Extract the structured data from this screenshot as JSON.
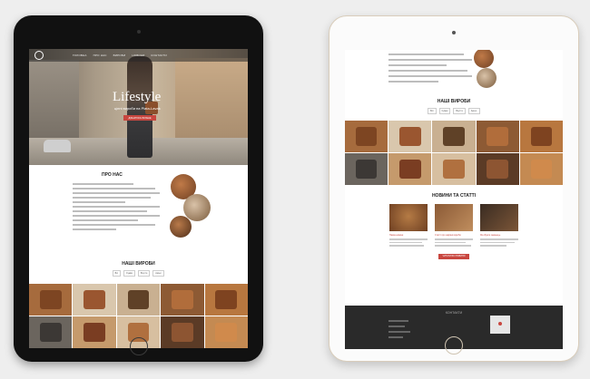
{
  "tablet_black": {
    "hero": {
      "title": "Lifestyle",
      "subtitle": "цінні вироби на Plata-Lavak",
      "button": "ДІЗНАТИСЬ БІЛЬШЕ",
      "nav": [
        "ГОЛОВНА",
        "ПРО НАС",
        "ВИРОБИ",
        "НОВИНИ",
        "КОНТАКТИ"
      ]
    },
    "about": {
      "title": "ПРО НАС"
    },
    "products": {
      "title": "НАШІ ВИРОБИ",
      "filters": [
        "Всі",
        "Сумки",
        "Взуття",
        "Аксес."
      ]
    }
  },
  "tablet_white": {
    "products": {
      "title": "НАШІ ВИРОБИ",
      "filters": [
        "Всі",
        "Сумки",
        "Взуття",
        "Аксес."
      ]
    },
    "news": {
      "title": "НОВИНИ ТА СТАТТІ",
      "cards": [
        {
          "title": "Назва новини"
        },
        {
          "title": "Статті про шкіряні вироби"
        },
        {
          "title": "Як обрати гаманець"
        }
      ],
      "button": "ЧИТАТИ ВСІ НОВИНИ"
    },
    "footer": {
      "title": "КОНТАКТИ"
    }
  },
  "colors": {
    "accent": "#c8463f",
    "leather": "#8a4f2c",
    "footer_bg": "#2a2a2a"
  }
}
